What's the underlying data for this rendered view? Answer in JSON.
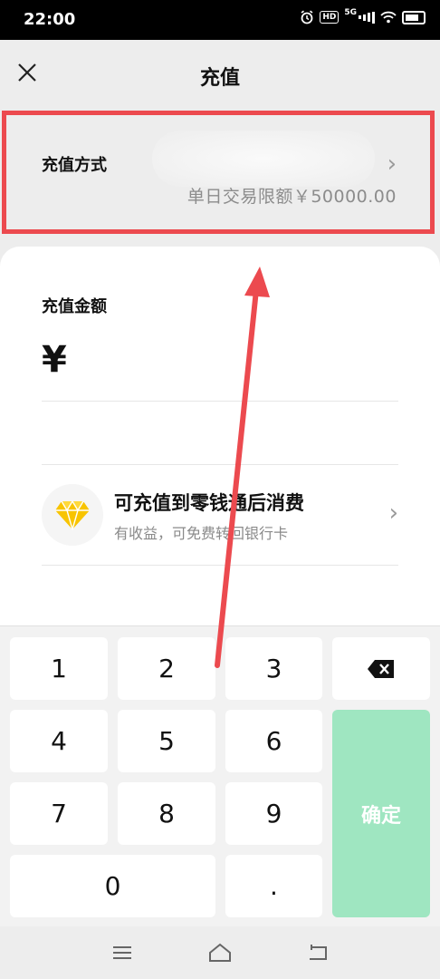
{
  "status_bar": {
    "time": "22:00",
    "network": "5G",
    "hd_badge": "HD"
  },
  "nav": {
    "close_icon": "close-icon",
    "title": "充值"
  },
  "method": {
    "label": "充值方式",
    "limit_text": "单日交易限额￥50000.00",
    "chevron": "›"
  },
  "amount": {
    "label": "充值金额",
    "currency": "¥",
    "value": ""
  },
  "promo": {
    "title": "可充值到零钱通后消费",
    "subtitle": "有收益，可免费转回银行卡",
    "icon": "diamond-icon",
    "chevron": "›"
  },
  "keypad": {
    "keys": [
      "1",
      "2",
      "3",
      "4",
      "5",
      "6",
      "7",
      "8",
      "9",
      "0",
      "."
    ],
    "delete_icon": "backspace-icon",
    "confirm_label": "确定"
  },
  "colors": {
    "highlight": "#ec4a4f",
    "confirm_bg": "#9fe6c1",
    "diamond": "#f8c400"
  }
}
